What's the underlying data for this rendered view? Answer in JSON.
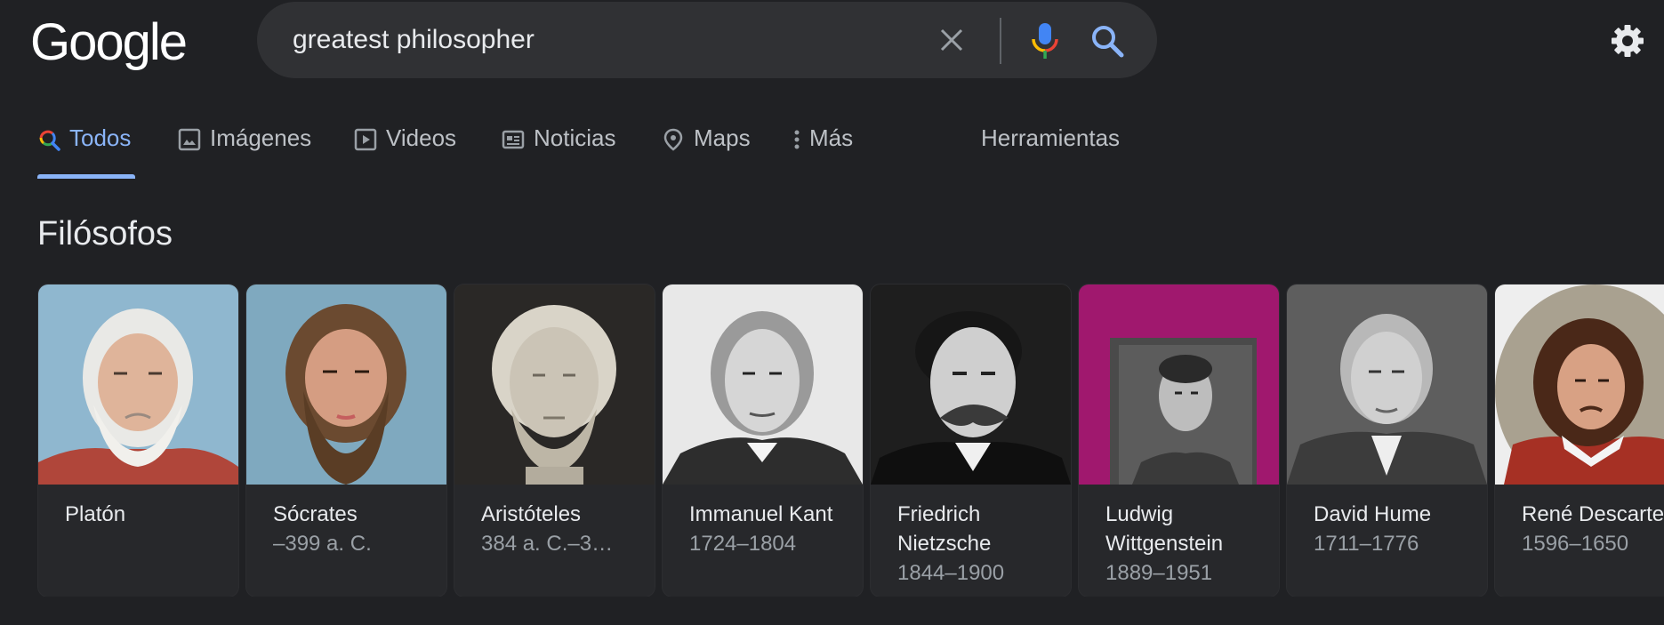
{
  "logo": {
    "text": "Google"
  },
  "search": {
    "query": "greatest philosopher"
  },
  "tabs": [
    {
      "label": "Todos",
      "icon": "search-color-icon",
      "active": true
    },
    {
      "label": "Imágenes",
      "icon": "image-icon"
    },
    {
      "label": "Videos",
      "icon": "play-icon"
    },
    {
      "label": "Noticias",
      "icon": "news-icon"
    },
    {
      "label": "Maps",
      "icon": "map-pin-icon"
    },
    {
      "label": "Más",
      "icon": "more-vert-icon"
    }
  ],
  "tools_label": "Herramientas",
  "section": {
    "title": "Filósofos"
  },
  "philosophers": [
    {
      "name": "Platón",
      "years": ""
    },
    {
      "name": "Sócrates",
      "years": "–399 a. C."
    },
    {
      "name": "Aristóteles",
      "years": "384 a. C.–3…"
    },
    {
      "name": "Immanuel Kant",
      "years": "1724–1804"
    },
    {
      "name": "Friedrich Nietzsche",
      "years": "1844–1900"
    },
    {
      "name": "Ludwig Wittgenstein",
      "years": "1889–1951"
    },
    {
      "name": "David Hume",
      "years": "1711–1776"
    },
    {
      "name": "René Descartes",
      "years": "1596–1650"
    }
  ],
  "colors": {
    "accent": "#8ab4f8",
    "background": "#202124",
    "card": "#27282b"
  }
}
